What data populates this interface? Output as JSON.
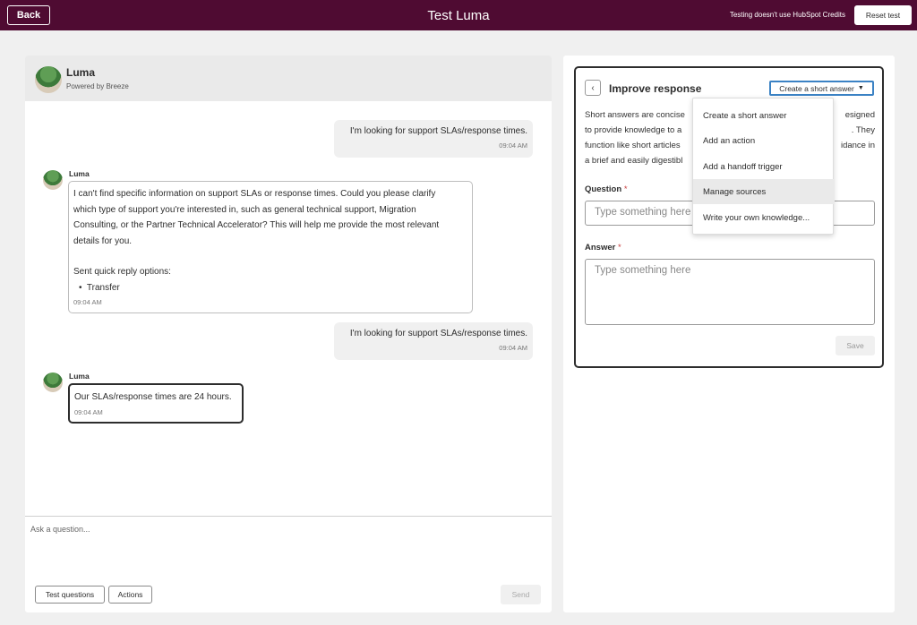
{
  "topbar": {
    "back_label": "Back",
    "title": "Test Luma",
    "credits_note": "Testing doesn't use HubSpot Credits",
    "reset_label": "Reset test",
    "bg_color": "#4f0b32"
  },
  "chat": {
    "bot_name": "Luma",
    "bot_subtitle": "Powered by Breeze",
    "messages": [
      {
        "from": "user",
        "text": "I'm looking for support SLAs/response times.",
        "time": "09:04 AM"
      },
      {
        "from": "bot",
        "sender": "Luma",
        "lines": [
          "I can't find specific information on support SLAs or response times. Could you please clarify",
          "which type of support you're interested in, such as general technical support, Migration",
          "Consulting, or the Partner Technical Accelerator? This will help me provide the most relevant",
          "details for you."
        ],
        "quick_reply_heading": "Sent quick reply options:",
        "quick_reply": "Transfer",
        "time": "09:04 AM"
      },
      {
        "from": "user",
        "text": "I'm looking for support SLAs/response times.",
        "time": "09:04 AM"
      },
      {
        "from": "bot",
        "sender": "Luma",
        "text": "Our SLAs/response times are 24 hours.",
        "time": "09:04 AM"
      }
    ],
    "input_placeholder": "Ask a question...",
    "test_questions_label": "Test questions",
    "actions_label": "Actions",
    "send_label": "Send"
  },
  "improve": {
    "title": "Improve response",
    "type_selected": "Create a short answer",
    "description_lines": [
      "Short answers are concise",
      "to provide knowledge to a",
      "function like short articles",
      "a brief and easily digestibl"
    ],
    "description_lines_right": [
      "esigned",
      ". They",
      "idance in"
    ],
    "question_label": "Question",
    "question_placeholder": "Type something here",
    "answer_label": "Answer",
    "answer_placeholder": "Type something here",
    "required_mark": "*",
    "save_label": "Save"
  },
  "dropdown": {
    "items": [
      {
        "label": "Create a short answer"
      },
      {
        "label": "Add an action"
      },
      {
        "label": "Add a handoff trigger"
      },
      {
        "label": "Manage sources"
      },
      {
        "label": "Write your own knowledge..."
      }
    ],
    "highlighted_index": 3
  }
}
